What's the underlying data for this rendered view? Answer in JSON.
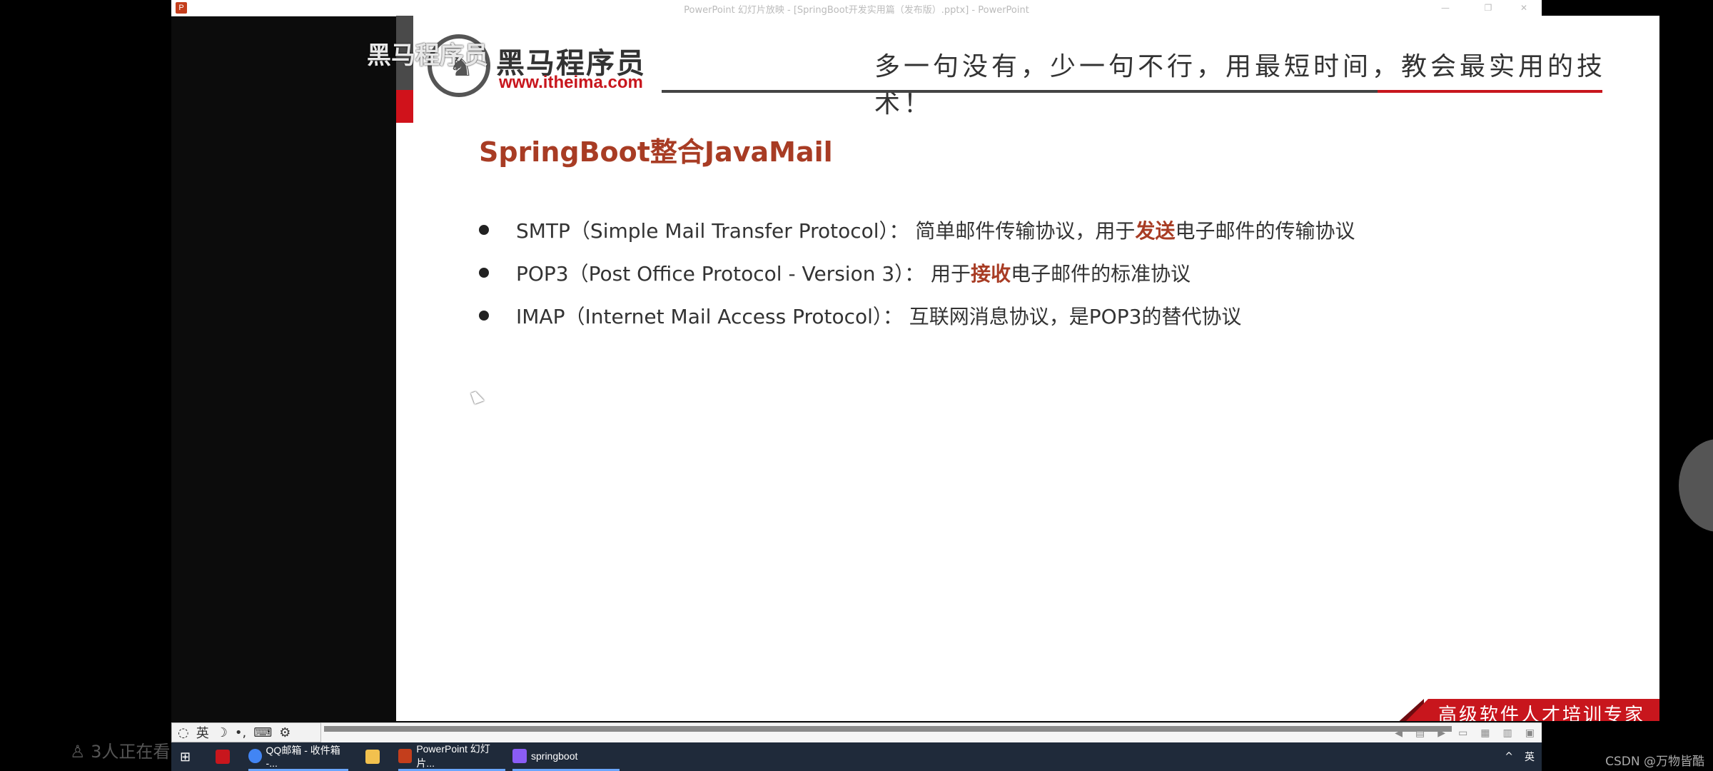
{
  "window": {
    "title": "PowerPoint 幻灯片放映 - [SpringBoot开发实用篇（发布版）.pptx] - PowerPoint",
    "app_icon": "P",
    "controls": [
      "—",
      "❐",
      "✕"
    ]
  },
  "watermark": {
    "text": "黑马程序员"
  },
  "slide": {
    "logo": {
      "name": "黑马程序员",
      "url": "www.itheima.com",
      "icon": "horse-logo-icon"
    },
    "slogan": "多一句没有，少一句不行，用最短时间，教会最实用的技术！",
    "title": "SpringBoot整合JavaMail",
    "bullets": [
      {
        "pre": "SMTP（Simple Mail Transfer Protocol）：  简单邮件传输协议，用于",
        "em": "发送",
        "post": "电子邮件的传输协议"
      },
      {
        "pre": "POP3（Post Office Protocol - Version 3）：  用于",
        "em": "接收",
        "post": "电子邮件的标准协议"
      },
      {
        "pre": "IMAP（Internet Mail Access Protocol）：  互联网消息协议，是POP3的替代协议",
        "em": "",
        "post": ""
      }
    ],
    "footer": "高级软件人才培训专家"
  },
  "ime": {
    "mode": "英",
    "moon": "☽",
    "punct": "•,",
    "keyboard": "⌨",
    "settings": "⚙"
  },
  "taskbar": {
    "items": [
      {
        "label": "QQ邮箱 - 收件箱 -...",
        "color": "#4285f4"
      },
      {
        "label": "PowerPoint 幻灯片...",
        "color": "#c43e1c"
      },
      {
        "label": "springboot",
        "color": "#8a5cf6"
      }
    ],
    "tray": {
      "caret": "^",
      "lang": "英"
    }
  },
  "overlay": {
    "viewers": "3人正在看",
    "csdn": "CSDN @万物皆酷"
  },
  "colors": {
    "accent": "#a83c24",
    "brand_red": "#c8161d"
  }
}
